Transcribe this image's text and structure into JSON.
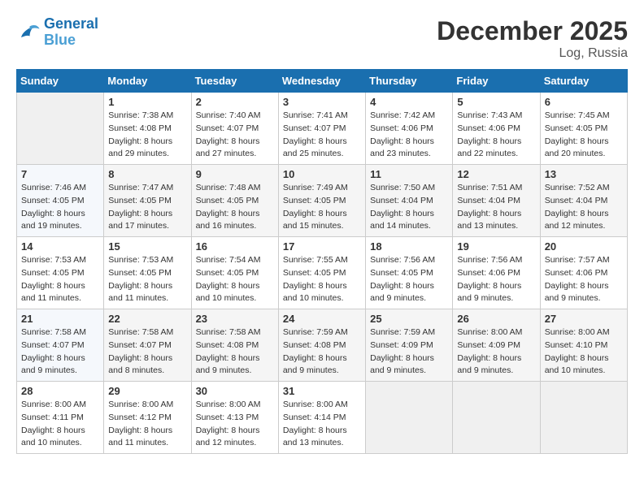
{
  "logo": {
    "line1": "General",
    "line2": "Blue"
  },
  "title": "December 2025",
  "location": "Log, Russia",
  "days_header": [
    "Sunday",
    "Monday",
    "Tuesday",
    "Wednesday",
    "Thursday",
    "Friday",
    "Saturday"
  ],
  "weeks": [
    [
      {
        "day": "",
        "sunrise": "",
        "sunset": "",
        "daylight": ""
      },
      {
        "day": "1",
        "sunrise": "Sunrise: 7:38 AM",
        "sunset": "Sunset: 4:08 PM",
        "daylight": "Daylight: 8 hours and 29 minutes."
      },
      {
        "day": "2",
        "sunrise": "Sunrise: 7:40 AM",
        "sunset": "Sunset: 4:07 PM",
        "daylight": "Daylight: 8 hours and 27 minutes."
      },
      {
        "day": "3",
        "sunrise": "Sunrise: 7:41 AM",
        "sunset": "Sunset: 4:07 PM",
        "daylight": "Daylight: 8 hours and 25 minutes."
      },
      {
        "day": "4",
        "sunrise": "Sunrise: 7:42 AM",
        "sunset": "Sunset: 4:06 PM",
        "daylight": "Daylight: 8 hours and 23 minutes."
      },
      {
        "day": "5",
        "sunrise": "Sunrise: 7:43 AM",
        "sunset": "Sunset: 4:06 PM",
        "daylight": "Daylight: 8 hours and 22 minutes."
      },
      {
        "day": "6",
        "sunrise": "Sunrise: 7:45 AM",
        "sunset": "Sunset: 4:05 PM",
        "daylight": "Daylight: 8 hours and 20 minutes."
      }
    ],
    [
      {
        "day": "7",
        "sunrise": "Sunrise: 7:46 AM",
        "sunset": "Sunset: 4:05 PM",
        "daylight": "Daylight: 8 hours and 19 minutes."
      },
      {
        "day": "8",
        "sunrise": "Sunrise: 7:47 AM",
        "sunset": "Sunset: 4:05 PM",
        "daylight": "Daylight: 8 hours and 17 minutes."
      },
      {
        "day": "9",
        "sunrise": "Sunrise: 7:48 AM",
        "sunset": "Sunset: 4:05 PM",
        "daylight": "Daylight: 8 hours and 16 minutes."
      },
      {
        "day": "10",
        "sunrise": "Sunrise: 7:49 AM",
        "sunset": "Sunset: 4:05 PM",
        "daylight": "Daylight: 8 hours and 15 minutes."
      },
      {
        "day": "11",
        "sunrise": "Sunrise: 7:50 AM",
        "sunset": "Sunset: 4:04 PM",
        "daylight": "Daylight: 8 hours and 14 minutes."
      },
      {
        "day": "12",
        "sunrise": "Sunrise: 7:51 AM",
        "sunset": "Sunset: 4:04 PM",
        "daylight": "Daylight: 8 hours and 13 minutes."
      },
      {
        "day": "13",
        "sunrise": "Sunrise: 7:52 AM",
        "sunset": "Sunset: 4:04 PM",
        "daylight": "Daylight: 8 hours and 12 minutes."
      }
    ],
    [
      {
        "day": "14",
        "sunrise": "Sunrise: 7:53 AM",
        "sunset": "Sunset: 4:05 PM",
        "daylight": "Daylight: 8 hours and 11 minutes."
      },
      {
        "day": "15",
        "sunrise": "Sunrise: 7:53 AM",
        "sunset": "Sunset: 4:05 PM",
        "daylight": "Daylight: 8 hours and 11 minutes."
      },
      {
        "day": "16",
        "sunrise": "Sunrise: 7:54 AM",
        "sunset": "Sunset: 4:05 PM",
        "daylight": "Daylight: 8 hours and 10 minutes."
      },
      {
        "day": "17",
        "sunrise": "Sunrise: 7:55 AM",
        "sunset": "Sunset: 4:05 PM",
        "daylight": "Daylight: 8 hours and 10 minutes."
      },
      {
        "day": "18",
        "sunrise": "Sunrise: 7:56 AM",
        "sunset": "Sunset: 4:05 PM",
        "daylight": "Daylight: 8 hours and 9 minutes."
      },
      {
        "day": "19",
        "sunrise": "Sunrise: 7:56 AM",
        "sunset": "Sunset: 4:06 PM",
        "daylight": "Daylight: 8 hours and 9 minutes."
      },
      {
        "day": "20",
        "sunrise": "Sunrise: 7:57 AM",
        "sunset": "Sunset: 4:06 PM",
        "daylight": "Daylight: 8 hours and 9 minutes."
      }
    ],
    [
      {
        "day": "21",
        "sunrise": "Sunrise: 7:58 AM",
        "sunset": "Sunset: 4:07 PM",
        "daylight": "Daylight: 8 hours and 9 minutes."
      },
      {
        "day": "22",
        "sunrise": "Sunrise: 7:58 AM",
        "sunset": "Sunset: 4:07 PM",
        "daylight": "Daylight: 8 hours and 8 minutes."
      },
      {
        "day": "23",
        "sunrise": "Sunrise: 7:58 AM",
        "sunset": "Sunset: 4:08 PM",
        "daylight": "Daylight: 8 hours and 9 minutes."
      },
      {
        "day": "24",
        "sunrise": "Sunrise: 7:59 AM",
        "sunset": "Sunset: 4:08 PM",
        "daylight": "Daylight: 8 hours and 9 minutes."
      },
      {
        "day": "25",
        "sunrise": "Sunrise: 7:59 AM",
        "sunset": "Sunset: 4:09 PM",
        "daylight": "Daylight: 8 hours and 9 minutes."
      },
      {
        "day": "26",
        "sunrise": "Sunrise: 8:00 AM",
        "sunset": "Sunset: 4:09 PM",
        "daylight": "Daylight: 8 hours and 9 minutes."
      },
      {
        "day": "27",
        "sunrise": "Sunrise: 8:00 AM",
        "sunset": "Sunset: 4:10 PM",
        "daylight": "Daylight: 8 hours and 10 minutes."
      }
    ],
    [
      {
        "day": "28",
        "sunrise": "Sunrise: 8:00 AM",
        "sunset": "Sunset: 4:11 PM",
        "daylight": "Daylight: 8 hours and 10 minutes."
      },
      {
        "day": "29",
        "sunrise": "Sunrise: 8:00 AM",
        "sunset": "Sunset: 4:12 PM",
        "daylight": "Daylight: 8 hours and 11 minutes."
      },
      {
        "day": "30",
        "sunrise": "Sunrise: 8:00 AM",
        "sunset": "Sunset: 4:13 PM",
        "daylight": "Daylight: 8 hours and 12 minutes."
      },
      {
        "day": "31",
        "sunrise": "Sunrise: 8:00 AM",
        "sunset": "Sunset: 4:14 PM",
        "daylight": "Daylight: 8 hours and 13 minutes."
      },
      {
        "day": "",
        "sunrise": "",
        "sunset": "",
        "daylight": ""
      },
      {
        "day": "",
        "sunrise": "",
        "sunset": "",
        "daylight": ""
      },
      {
        "day": "",
        "sunrise": "",
        "sunset": "",
        "daylight": ""
      }
    ]
  ]
}
